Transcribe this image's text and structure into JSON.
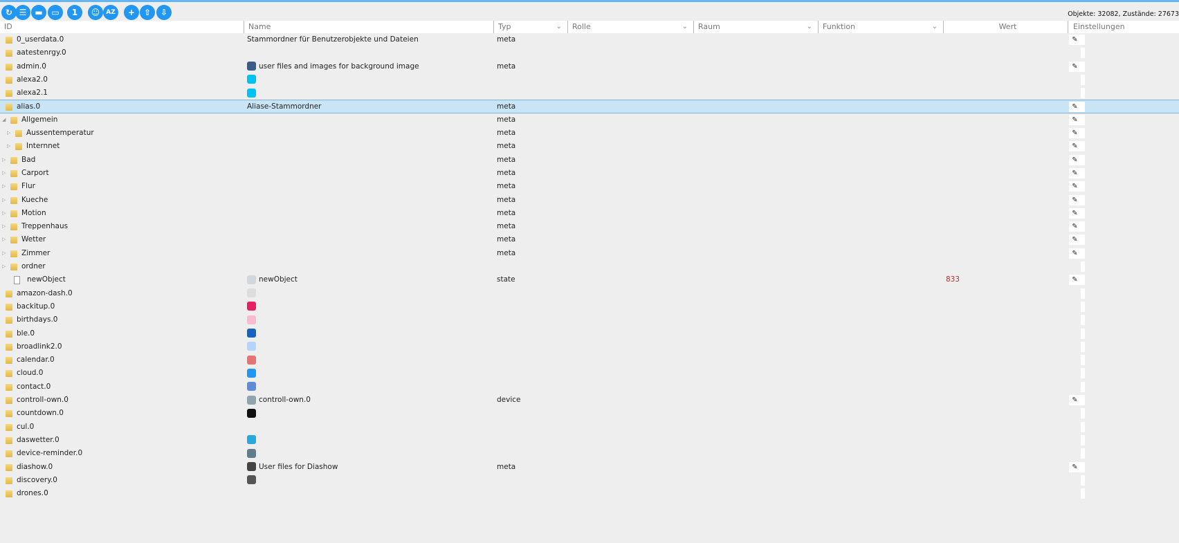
{
  "toolbar": {
    "buttons": [
      {
        "name": "refresh-button",
        "glyph": "↻"
      },
      {
        "name": "list-view-button",
        "glyph": "☰"
      },
      {
        "name": "folder-button",
        "glyph": "▬"
      },
      {
        "name": "folder-outline-button",
        "glyph": "▭"
      },
      {
        "name": "one-button",
        "glyph": "1"
      },
      {
        "name": "user-button",
        "glyph": "☺"
      },
      {
        "name": "sort-az-button",
        "glyph": "AZ"
      },
      {
        "name": "add-button",
        "glyph": "+"
      },
      {
        "name": "upload-button",
        "glyph": "⇧"
      },
      {
        "name": "download-button",
        "glyph": "⇩"
      }
    ],
    "counts": "Objekte: 32082, Zustände: 27673"
  },
  "columns": {
    "id": "ID",
    "name": "Name",
    "type": "Typ",
    "role": "Rolle",
    "room": "Raum",
    "function": "Funktion",
    "value": "Wert",
    "settings": "Einstellungen"
  },
  "colors": {
    "accent": "#2196f3",
    "selected": "#c9e5f5"
  },
  "rows": [
    {
      "id": "0_userdata.0",
      "level": 0,
      "name": "Stammordner für Benutzerobjekte und Dateien",
      "type": "meta",
      "edit": true
    },
    {
      "id": "aatestenrgy.0",
      "level": 0
    },
    {
      "id": "admin.0",
      "level": 0,
      "icon": "#3b5b8c",
      "name": "user files and images for background image",
      "type": "meta",
      "edit": true
    },
    {
      "id": "alexa2.0",
      "level": 0,
      "icon": "#00c3f2"
    },
    {
      "id": "alexa2.1",
      "level": 0,
      "icon": "#00c3f2"
    },
    {
      "id": "alias.0",
      "level": 0,
      "name": "Aliase-Stammordner",
      "type": "meta",
      "edit": true,
      "selected": true
    },
    {
      "id": "Allgemein",
      "level": 1,
      "exp": "open",
      "type": "meta",
      "edit": true
    },
    {
      "id": "Aussentemperatur",
      "level": 2,
      "exp": "closed",
      "type": "meta",
      "edit": true
    },
    {
      "id": "Internnet",
      "level": 2,
      "exp": "closed",
      "type": "meta",
      "edit": true
    },
    {
      "id": "Bad",
      "level": 1,
      "exp": "closed",
      "type": "meta",
      "edit": true
    },
    {
      "id": "Carport",
      "level": 1,
      "exp": "closed",
      "type": "meta",
      "edit": true
    },
    {
      "id": "Flur",
      "level": 1,
      "exp": "closed",
      "type": "meta",
      "edit": true
    },
    {
      "id": "Kueche",
      "level": 1,
      "exp": "closed",
      "type": "meta",
      "edit": true
    },
    {
      "id": "Motion",
      "level": 1,
      "exp": "closed",
      "type": "meta",
      "edit": true
    },
    {
      "id": "Treppenhaus",
      "level": 1,
      "exp": "closed",
      "type": "meta",
      "edit": true
    },
    {
      "id": "Wetter",
      "level": 1,
      "exp": "closed",
      "type": "meta",
      "edit": true
    },
    {
      "id": "Zimmer",
      "level": 1,
      "exp": "closed",
      "type": "meta",
      "edit": true
    },
    {
      "id": "ordner",
      "level": 1,
      "exp": "closed"
    },
    {
      "id": "newObject",
      "level": 1,
      "file": true,
      "icon": "#cfd8dc",
      "name": "newObject",
      "type": "state",
      "value": "833",
      "edit": true
    },
    {
      "id": "amazon-dash.0",
      "level": 0,
      "icon": "#dddddd"
    },
    {
      "id": "backitup.0",
      "level": 0,
      "icon": "#e91e63"
    },
    {
      "id": "birthdays.0",
      "level": 0,
      "icon": "#f8bbd0"
    },
    {
      "id": "ble.0",
      "level": 0,
      "icon": "#1565c0"
    },
    {
      "id": "broadlink2.0",
      "level": 0,
      "icon": "#b3d4fc"
    },
    {
      "id": "calendar.0",
      "level": 0,
      "icon": "#e57373"
    },
    {
      "id": "cloud.0",
      "level": 0,
      "icon": "#2196f3"
    },
    {
      "id": "contact.0",
      "level": 0,
      "icon": "#5c8dd6"
    },
    {
      "id": "controll-own.0",
      "level": 0,
      "icon": "#90a4ae",
      "name": "controll-own.0",
      "type": "device",
      "edit": true
    },
    {
      "id": "countdown.0",
      "level": 0,
      "icon": "#111111"
    },
    {
      "id": "cul.0",
      "level": 0
    },
    {
      "id": "daswetter.0",
      "level": 0,
      "icon": "#29a8e0"
    },
    {
      "id": "device-reminder.0",
      "level": 0,
      "icon": "#607d8b"
    },
    {
      "id": "diashow.0",
      "level": 0,
      "icon": "#444444",
      "name": "User files for Diashow",
      "type": "meta",
      "edit": true
    },
    {
      "id": "discovery.0",
      "level": 0,
      "icon": "#555555"
    },
    {
      "id": "drones.0",
      "level": 0
    }
  ]
}
